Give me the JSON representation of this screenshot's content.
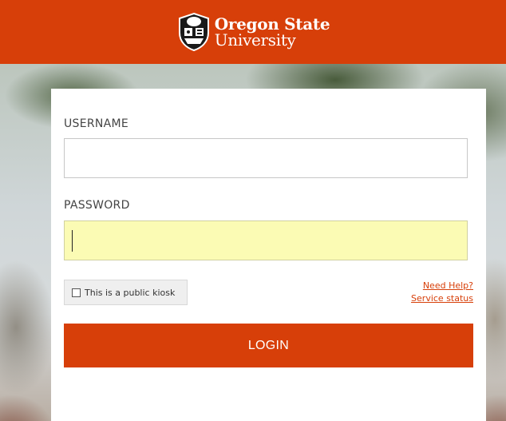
{
  "header": {
    "brand_line1": "Oregon State",
    "brand_line2": "University",
    "logo_icon": "osu-beaver-seal-icon",
    "color": "#d73f09"
  },
  "form": {
    "username_label": "USERNAME",
    "username_value": "",
    "password_label": "PASSWORD",
    "password_value": "",
    "kiosk_label": "This is a public kiosk",
    "kiosk_checked": false,
    "help_link": "Need Help?",
    "status_link": "Service status",
    "login_label": "LOGIN"
  },
  "colors": {
    "accent": "#d73f09",
    "password_bg": "#fbfbb4"
  }
}
